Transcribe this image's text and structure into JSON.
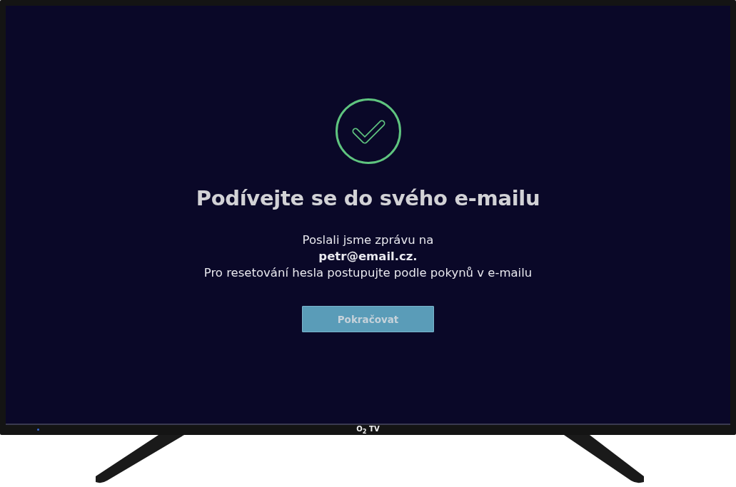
{
  "screen": {
    "title": "Podívejte se do svého e-mailu",
    "message": [
      "Poslali jsme zprávu na",
      "**petr@email.cz.**",
      "Pro resetování hesla postupujte podle pokynů v e-mailu"
    ],
    "button": "Pokračovat"
  },
  "tv": {
    "logo": "O$_{2}$ TV"
  }
}
